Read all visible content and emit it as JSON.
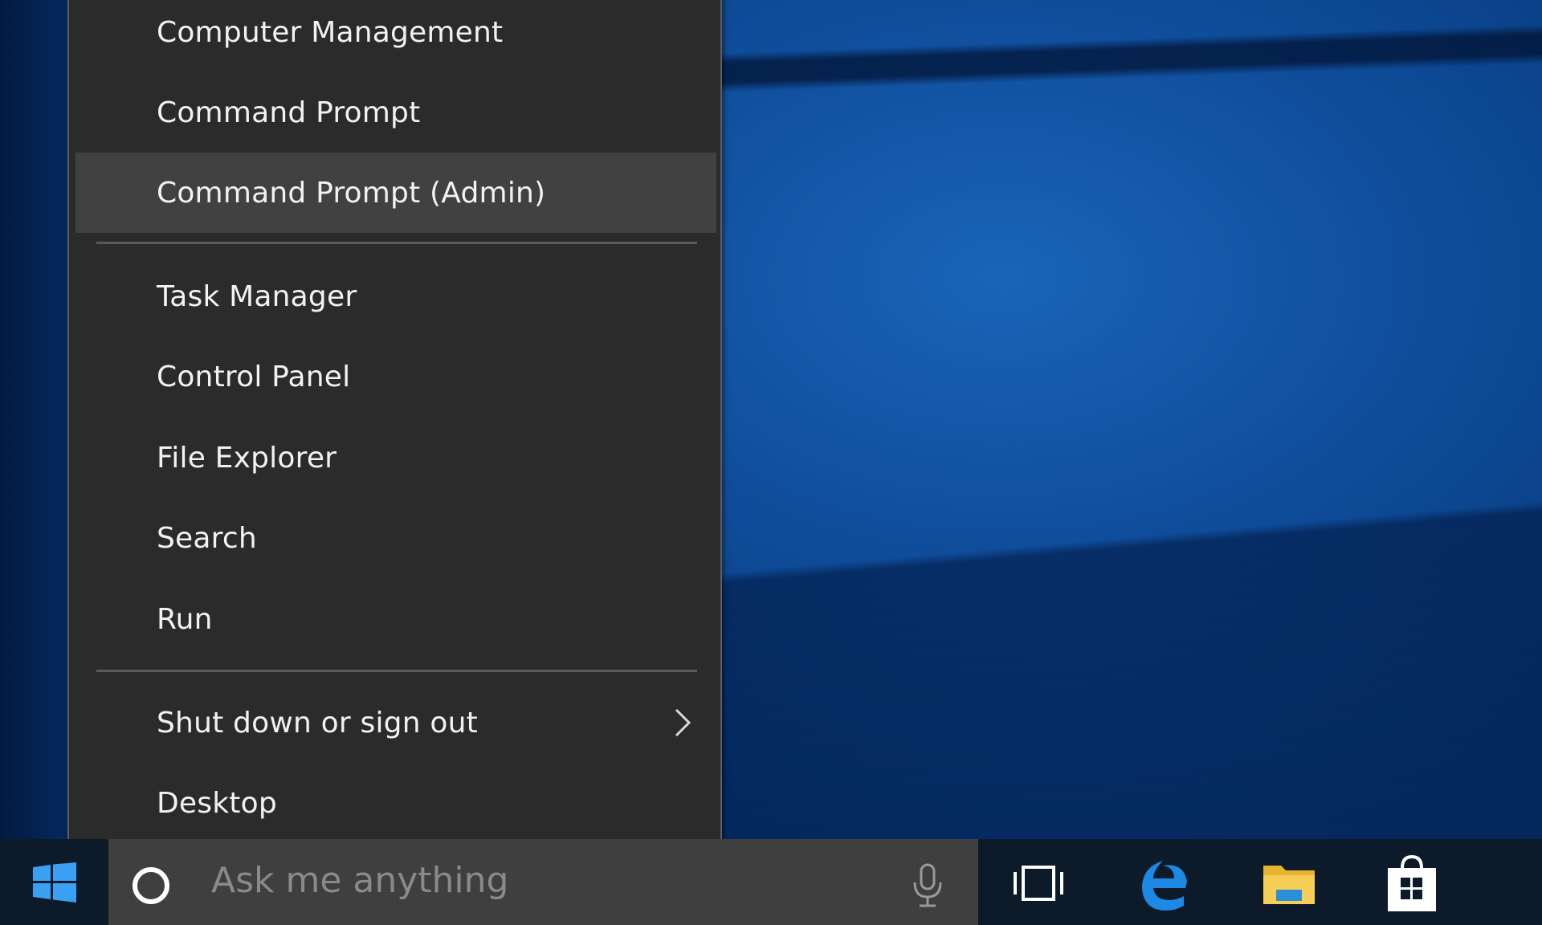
{
  "context_menu": {
    "items": [
      {
        "label": "Computer Management"
      },
      {
        "label": "Command Prompt"
      },
      {
        "label": "Command Prompt (Admin)"
      },
      {
        "label": "Task Manager"
      },
      {
        "label": "Control Panel"
      },
      {
        "label": "File Explorer"
      },
      {
        "label": "Search"
      },
      {
        "label": "Run"
      },
      {
        "label": "Shut down or sign out"
      },
      {
        "label": "Desktop"
      }
    ],
    "highlighted_item": "Command Prompt (Admin)",
    "submenu_icon": "chevron-right-icon"
  },
  "taskbar": {
    "start_icon": "windows-logo-icon",
    "search": {
      "placeholder": "Ask me anything",
      "cortana_icon": "cortana-ring-icon",
      "mic_icon": "microphone-icon"
    },
    "pinned": [
      {
        "name": "task-view-icon"
      },
      {
        "name": "edge-icon"
      },
      {
        "name": "file-explorer-icon"
      },
      {
        "name": "store-icon"
      }
    ],
    "colors": {
      "accent_blue": "#1e88e5",
      "folder_yellow": "#f4c542",
      "menu_bg": "#2b2b2b",
      "menu_highlight": "#414141"
    }
  }
}
